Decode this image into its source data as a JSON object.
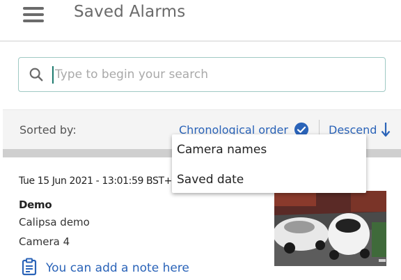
{
  "header": {
    "title": "Saved Alarms",
    "menu_icon": "hamburger-menu-icon"
  },
  "search": {
    "placeholder": "Type to begin your search",
    "value": "",
    "icon": "search-icon"
  },
  "sort": {
    "label": "Sorted by:",
    "order_label": "Chronological order",
    "order_icon": "check-circle-icon",
    "direction_label": "Descend",
    "direction_icon": "arrow-down-icon"
  },
  "sort_menu": {
    "options": [
      "Camera names",
      "Saved date"
    ]
  },
  "alarms": [
    {
      "timestamp": "Tue 15 Jun 2021 - 13:01:59 BST+",
      "site": "Demo",
      "group": "Calipsa demo",
      "camera": "Camera 4",
      "note_prompt": "You can add a note here",
      "note_icon": "clipboard-icon"
    }
  ],
  "colors": {
    "accent": "#2a63b8",
    "search_border": "#9fc9c4",
    "caret": "#1d7a6e"
  }
}
